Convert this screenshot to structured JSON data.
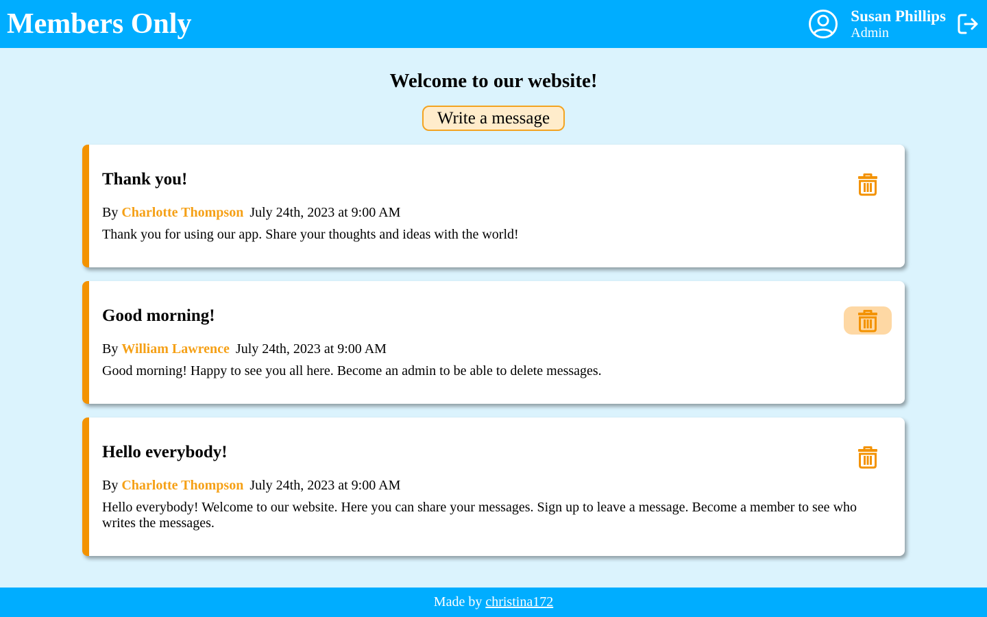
{
  "header": {
    "brand": "Members Only",
    "user": {
      "name": "Susan Phillips",
      "role": "Admin"
    },
    "avatar_icon": "user-circle-icon",
    "logout_icon": "logout-icon"
  },
  "main": {
    "welcome": "Welcome to our website!",
    "write_button": "Write a message"
  },
  "messages": [
    {
      "title": "Thank you!",
      "by": "By",
      "author": "Charlotte Thompson",
      "date": "July 24th, 2023 at 9:00 AM",
      "body": "Thank you for using our app. Share your thoughts and ideas with the world!",
      "delete_hover": false
    },
    {
      "title": "Good morning!",
      "by": "By",
      "author": "William Lawrence",
      "date": "July 24th, 2023 at 9:00 AM",
      "body": "Good morning! Happy to see you all here. Become an admin to be able to delete messages.",
      "delete_hover": true
    },
    {
      "title": "Hello everybody!",
      "by": "By",
      "author": "Charlotte Thompson",
      "date": "July 24th, 2023 at 9:00 AM",
      "body": "Hello everybody! Welcome to our website. Here you can share your messages. Sign up to leave a message. Become a member to see who writes the messages.",
      "delete_hover": false
    }
  ],
  "footer": {
    "prefix": "Made by",
    "link": "christina172"
  },
  "colors": {
    "header_bg": "#00adff",
    "page_bg": "#dbf3fd",
    "accent": "#f39200",
    "author": "#f5a016",
    "button_bg": "#ffeccb",
    "trash_hover_bg": "#fed8a4"
  }
}
